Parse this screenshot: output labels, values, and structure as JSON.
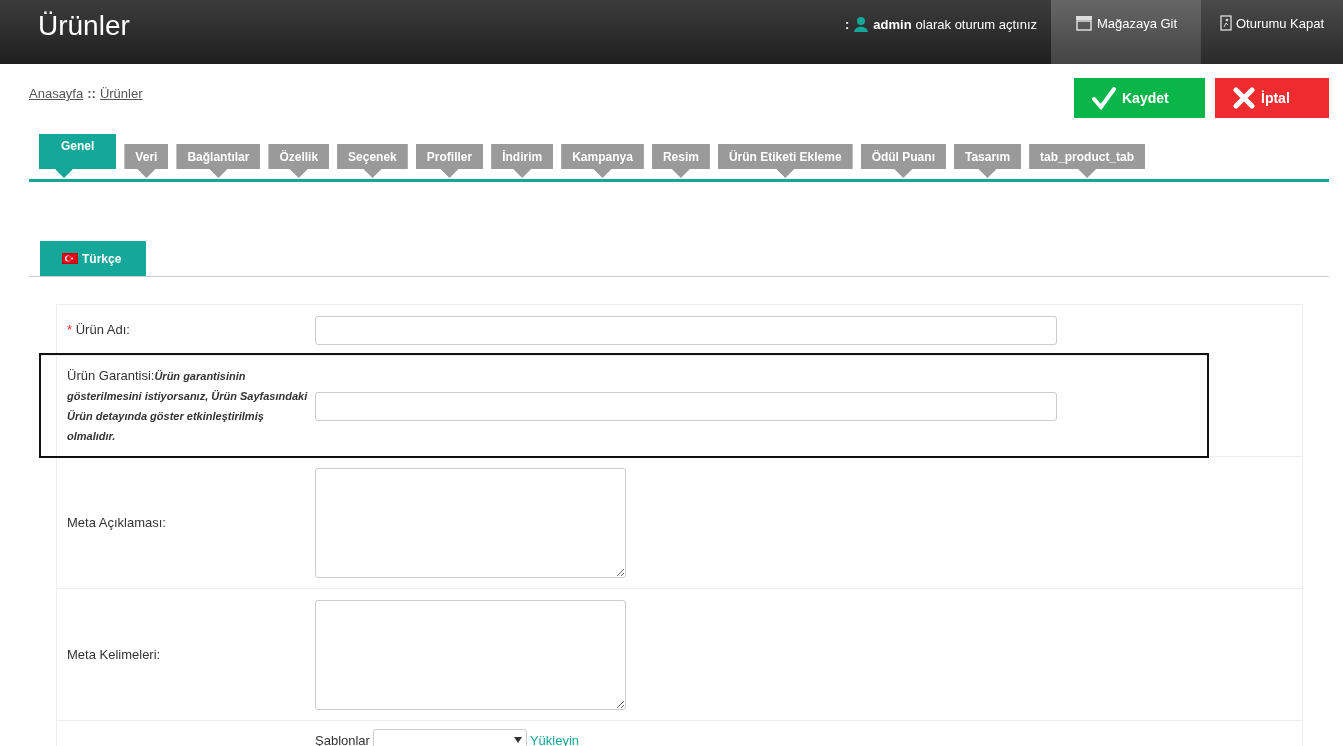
{
  "header": {
    "title": "Ürünler",
    "user_prefix": ":",
    "user_name": "admin",
    "user_suffix": "olarak oturum açtınız",
    "actions": [
      {
        "label": "Mağazaya Git",
        "kind": "store",
        "selected": true
      },
      {
        "label": "Oturumu Kapat",
        "kind": "logout",
        "selected": false
      }
    ]
  },
  "breadcrumb": {
    "items": [
      "Anasayfa",
      "Ürünler"
    ],
    "separator": "::"
  },
  "buttons": [
    {
      "label": "Kaydet",
      "kind": "save"
    },
    {
      "label": "İptal",
      "kind": "cancel"
    }
  ],
  "tabs": [
    {
      "label": "Genel",
      "selected": true
    },
    {
      "label": "Veri",
      "selected": false
    },
    {
      "label": "Bağlantılar",
      "selected": false
    },
    {
      "label": "Özellik",
      "selected": false
    },
    {
      "label": "Seçenek",
      "selected": false
    },
    {
      "label": "Profiller",
      "selected": false
    },
    {
      "label": "İndirim",
      "selected": false
    },
    {
      "label": "Kampanya",
      "selected": false
    },
    {
      "label": "Resim",
      "selected": false
    },
    {
      "label": "Ürün Etiketi Ekleme",
      "selected": false
    },
    {
      "label": "Ödül Puanı",
      "selected": false
    },
    {
      "label": "Tasarım",
      "selected": false
    },
    {
      "label": "tab_product_tab",
      "selected": false
    }
  ],
  "language_tabs": [
    {
      "label": "Türkçe",
      "selected": true
    }
  ],
  "form": [
    {
      "kind": "text",
      "label": "Ürün Adı:",
      "required_mark": "*",
      "highlighted": false
    },
    {
      "kind": "text",
      "label": "Ürün Garantisi:",
      "note": "Ürün garantisinin gösterilmesini istiyorsanız, Ürün Sayfasındaki Ürün detayında göster etkinleştirilmiş olmalıdır.",
      "highlighted": true
    },
    {
      "kind": "textarea",
      "label": "Meta Açıklaması:",
      "highlighted": false
    },
    {
      "kind": "textarea",
      "label": "Meta Kelimeleri:",
      "highlighted": false
    },
    {
      "kind": "template",
      "select_label": "Şablonlar",
      "link": "Yükleyin",
      "highlighted": false
    }
  ]
}
